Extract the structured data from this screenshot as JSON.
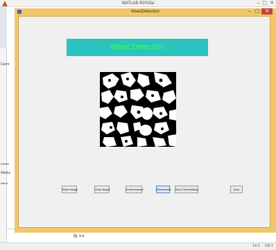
{
  "matlab": {
    "title": "MATLAB R2015a",
    "window_buttons": [
      "–",
      "▢",
      "✕"
    ],
    "left_labels": {
      "curre": "Curre",
      "details": "Details",
      "workspace": "Works",
      "name": "Name"
    },
    "command_prompt": "fx >>",
    "status": {
      "ln": "Ln 1",
      "col": "Col 1"
    }
  },
  "gui": {
    "window_title": "WeedDetection",
    "window_buttons": [
      "–",
      "▢",
      "✕"
    ],
    "heading": "Weed Detection",
    "buttons": [
      "Read Image",
      "Gray Image",
      "Enhancement",
      "Binarization",
      "Area Thresholding",
      "Area"
    ]
  },
  "colors": {
    "gui_frame": "#f0c86a",
    "title_panel_bg": "#29c4bd",
    "title_panel_text": "#43ff4a",
    "close_button": "#c7463a"
  }
}
